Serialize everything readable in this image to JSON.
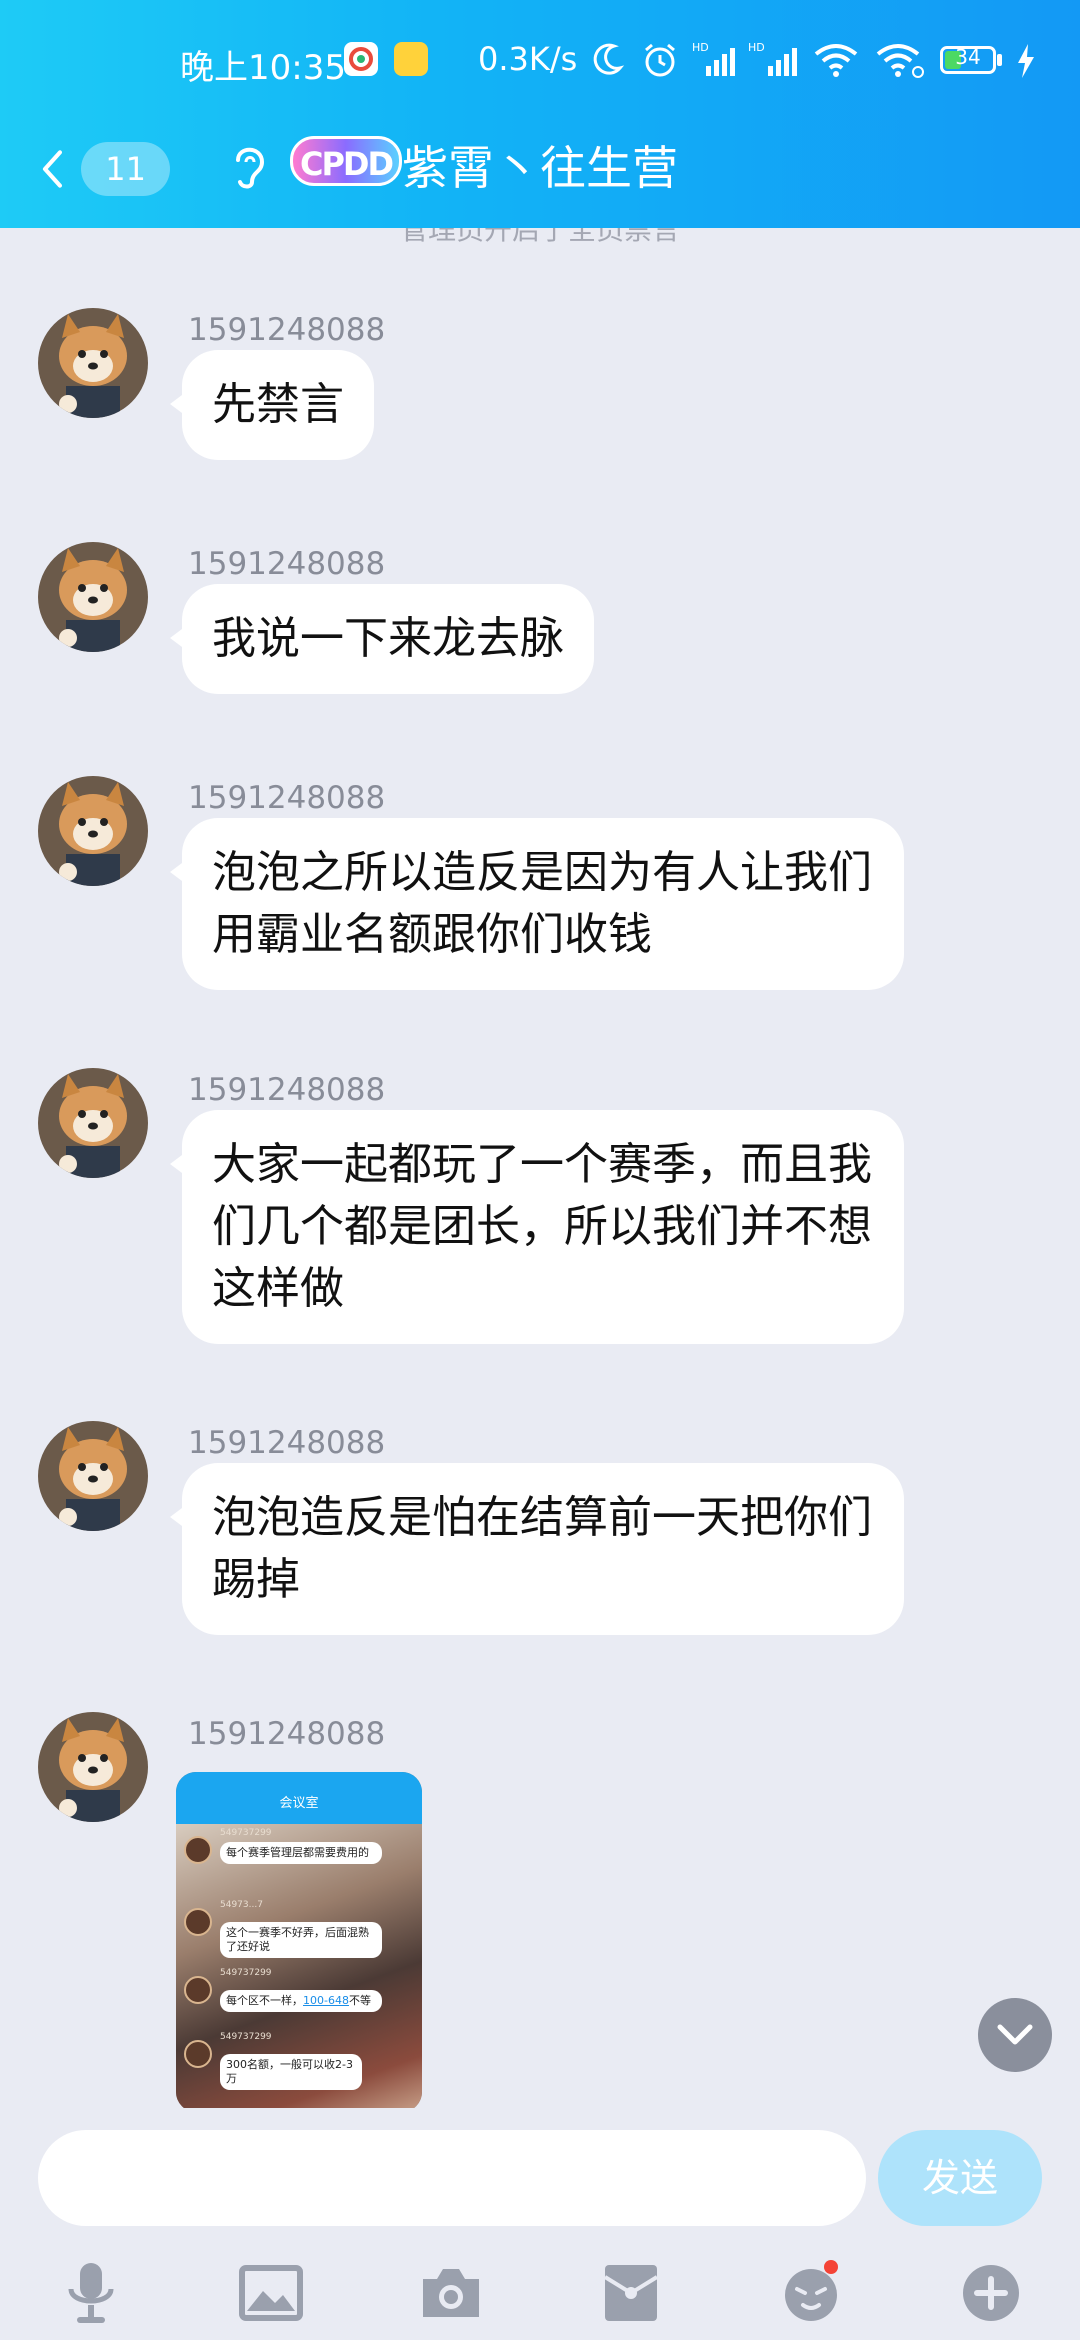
{
  "status": {
    "time": "晚上10:35",
    "network_speed": "0.3K/s",
    "battery": "34",
    "battery_level": 0.34
  },
  "header": {
    "back_badge": "11",
    "logo_text": "CPDD",
    "title": "紫霄丶往生营"
  },
  "notice": "管理员开启了全员禁言",
  "messages": [
    {
      "sender": "1591248088",
      "text": "先禁言"
    },
    {
      "sender": "1591248088",
      "text": "我说一下来龙去脉"
    },
    {
      "sender": "1591248088",
      "text": "泡泡之所以造反是因为有人让我们用霸业名额跟你们收钱"
    },
    {
      "sender": "1591248088",
      "text": "大家一起都玩了一个赛季，而且我们几个都是团长，所以我们并不想这样做"
    },
    {
      "sender": "1591248088",
      "text": "泡泡造反是怕在结算前一天把你们踢掉"
    },
    {
      "sender": "1591248088",
      "text": ""
    }
  ],
  "image_message": {
    "title": "会议室",
    "bubbles": [
      {
        "sender": "549737299",
        "text": "每个赛季管理层都需要费用的"
      },
      {
        "sender": "54973...7",
        "text": "这个一赛季不好弄，后面混熟了还好说"
      },
      {
        "sender": "549737299",
        "text_before": "每个区不一样，",
        "link": "100-648",
        "text_after": "不等"
      },
      {
        "sender": "549737299",
        "text": "300名额，一般可以收2-3万"
      }
    ]
  },
  "input": {
    "placeholder": "",
    "send_label": "发送"
  },
  "toolbar": [
    "mic-icon",
    "image-icon",
    "camera-icon",
    "red-packet-icon",
    "emoji-icon",
    "plus-icon"
  ],
  "colors": {
    "header_start": "#1ecbf6",
    "header_end": "#1399f5",
    "background": "#e9ebf3",
    "send_button": "#aee3fb"
  }
}
